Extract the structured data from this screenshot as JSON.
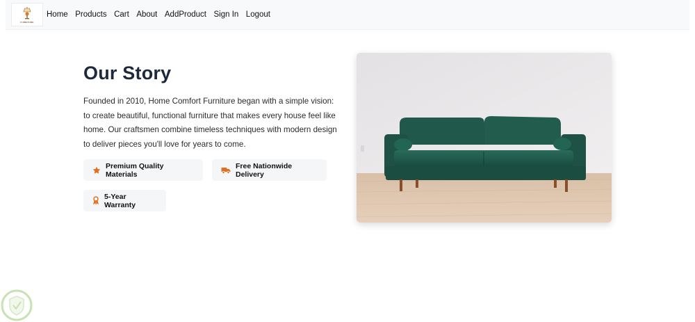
{
  "nav": {
    "brand_text": "FURNITURE",
    "links": [
      "Home",
      "Products",
      "Cart",
      "About",
      "AddProduct",
      "Sign In",
      "Logout"
    ]
  },
  "story": {
    "title": "Our Story",
    "body": "Founded in 2010, Home Comfort Furniture began with a simple vision: to create beautiful, functional furniture that makes every house feel like home. Our craftsmen combine timeless techniques with modern design to deliver pieces you'll love for years to come."
  },
  "features": [
    {
      "label": "Premium Quality Materials",
      "icon": "star-icon"
    },
    {
      "label": "Free Nationwide Delivery",
      "icon": "truck-icon"
    },
    {
      "label": "5-Year Warranty",
      "icon": "award-icon"
    }
  ],
  "colors": {
    "accent": "#e0701e",
    "title": "#1e2a3b",
    "nav_bg": "#f8f9fa",
    "badge_bg": "#f5f6f8",
    "sofa": "#1f5a4b"
  }
}
